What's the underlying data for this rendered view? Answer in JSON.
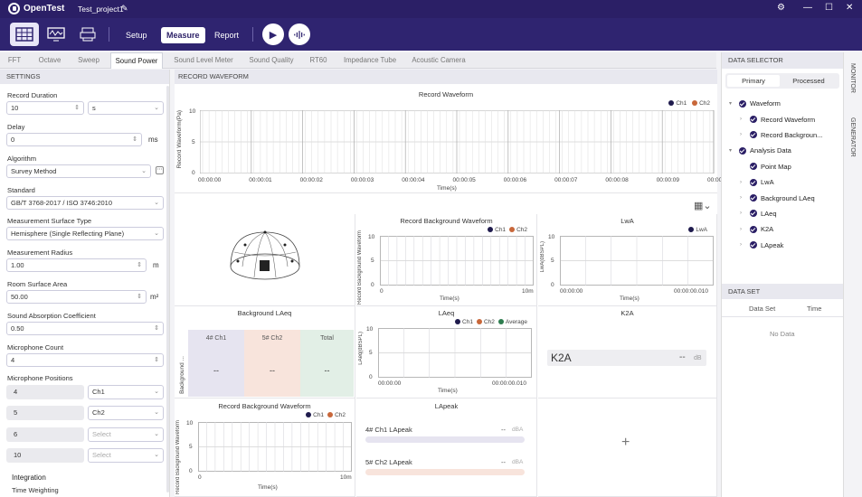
{
  "app": {
    "name": "OpenTest",
    "project": "Test_project1"
  },
  "menu": {
    "setup": "Setup",
    "measure": "Measure",
    "report": "Report"
  },
  "tabs": [
    "FFT",
    "Octave",
    "Sweep",
    "Sound Power",
    "Sound Level Meter",
    "Sound Quality",
    "RT60",
    "Impedance Tube",
    "Acoustic Camera"
  ],
  "settings": {
    "title": "SETTINGS",
    "record_duration": {
      "label": "Record Duration",
      "value": "10",
      "unit": "s"
    },
    "delay": {
      "label": "Delay",
      "value": "0",
      "unit": "ms"
    },
    "algorithm": {
      "label": "Algorithm",
      "value": "Survey Method"
    },
    "standard": {
      "label": "Standard",
      "value": "GB/T 3768-2017 / ISO 3746:2010"
    },
    "surface": {
      "label": "Measurement Surface Type",
      "value": "Hemisphere (Single Reflecting Plane)"
    },
    "radius": {
      "label": "Measurement Radius",
      "value": "1.00",
      "unit": "m"
    },
    "area": {
      "label": "Room Surface Area",
      "value": "50.00",
      "unit": "m²"
    },
    "absorption": {
      "label": "Sound Absorption Coefficient",
      "value": "0.50"
    },
    "mic_count": {
      "label": "Microphone Count",
      "value": "4"
    },
    "mic_positions": {
      "label": "Microphone Positions",
      "rows": [
        {
          "num": "4",
          "sel": "Ch1"
        },
        {
          "num": "5",
          "sel": "Ch2"
        },
        {
          "num": "6",
          "sel": "Select"
        },
        {
          "num": "10",
          "sel": "Select"
        }
      ]
    },
    "integration": "Integration",
    "time_weighting": "Time Weighting"
  },
  "main": {
    "section": "RECORD WAVEFORM",
    "record_waveform": {
      "title": "Record Waveform",
      "ylabel": "Record Waveform(Pa)",
      "xlabel": "Time(s)",
      "yticks": [
        "10",
        "5",
        "0"
      ],
      "xticks": [
        "00:00:00",
        "00:00:01",
        "00:00:02",
        "00:00:03",
        "00:00:04",
        "00:00:05",
        "00:00:06",
        "00:00:07",
        "00:00:08",
        "00:00:09",
        "00:00:10"
      ],
      "legend": [
        "Ch1",
        "Ch2"
      ]
    },
    "bg_laeq": {
      "title": "Background LAeq",
      "side": "Background ...",
      "cols": [
        {
          "head": "4# Ch1",
          "val": "--"
        },
        {
          "head": "5# Ch2",
          "val": "--"
        },
        {
          "head": "Total",
          "val": "--"
        }
      ]
    },
    "rbw1": {
      "title": "Record Background Waveform",
      "ylabel": "Record Background Waveform",
      "xlabel": "Time(s)",
      "yticks": [
        "10",
        "5",
        "0"
      ],
      "xticks": [
        "0",
        "10m"
      ],
      "legend": [
        "Ch1",
        "Ch2"
      ]
    },
    "lwa": {
      "title": "LwA",
      "ylabel": "LwA(dBSPL)",
      "xlabel": "Time(s)",
      "yticks": [
        "10",
        "5",
        "0"
      ],
      "xticks": [
        "00:00:00",
        "00:00:00.010"
      ],
      "legend": [
        "LwA"
      ]
    },
    "laeq": {
      "title": "LAeq",
      "ylabel": "LAeq(dBSPL)",
      "xlabel": "Time(s)",
      "yticks": [
        "10",
        "5",
        "0"
      ],
      "xticks": [
        "00:00:00",
        "00:00:00.010"
      ],
      "legend": [
        "Ch1",
        "Ch2",
        "Average"
      ]
    },
    "k2a": {
      "title": "K2A",
      "label": "K2A",
      "value": "--",
      "unit": "dB"
    },
    "rbw2": {
      "title": "Record Background Waveform",
      "ylabel": "Record Background Waveform",
      "xlabel": "Time(s)",
      "yticks": [
        "10",
        "5",
        "0"
      ],
      "xticks": [
        "0",
        "10m"
      ],
      "legend": [
        "Ch1",
        "Ch2"
      ]
    },
    "lapeak": {
      "title": "LApeak",
      "rows": [
        {
          "label": "4# Ch1 LApeak",
          "value": "--",
          "unit": "dBA"
        },
        {
          "label": "5# Ch2 LApeak",
          "value": "--",
          "unit": "dBA"
        }
      ]
    }
  },
  "right": {
    "title": "DATA SELECTOR",
    "tab_primary": "Primary",
    "tab_processed": "Processed",
    "tree": [
      {
        "label": "Waveform",
        "level": 0,
        "exp": "▾"
      },
      {
        "label": "Record Waveform",
        "level": 1,
        "exp": "›"
      },
      {
        "label": "Record Backgroun...",
        "level": 1,
        "exp": "›"
      },
      {
        "label": "Analysis Data",
        "level": 0,
        "exp": "▾"
      },
      {
        "label": "Point Map",
        "level": 1,
        "exp": ""
      },
      {
        "label": "LwA",
        "level": 1,
        "exp": "›"
      },
      {
        "label": "Background LAeq",
        "level": 1,
        "exp": "›"
      },
      {
        "label": "LAeq",
        "level": 1,
        "exp": "›"
      },
      {
        "label": "K2A",
        "level": 1,
        "exp": "›"
      },
      {
        "label": "LApeak",
        "level": 1,
        "exp": "›"
      }
    ],
    "dataset": {
      "title": "DATA SET",
      "col1": "Data Set",
      "col2": "Time",
      "empty": "No Data"
    },
    "side_monitor": "MONITOR",
    "side_generator": "GENERATOR"
  },
  "colors": {
    "ch1": "#1f1b4d",
    "ch2": "#c8673a",
    "average": "#2e7d4f",
    "bg1": "#e6e4f0",
    "bg2": "#f8e4dc",
    "bg3": "#e2efe6"
  }
}
